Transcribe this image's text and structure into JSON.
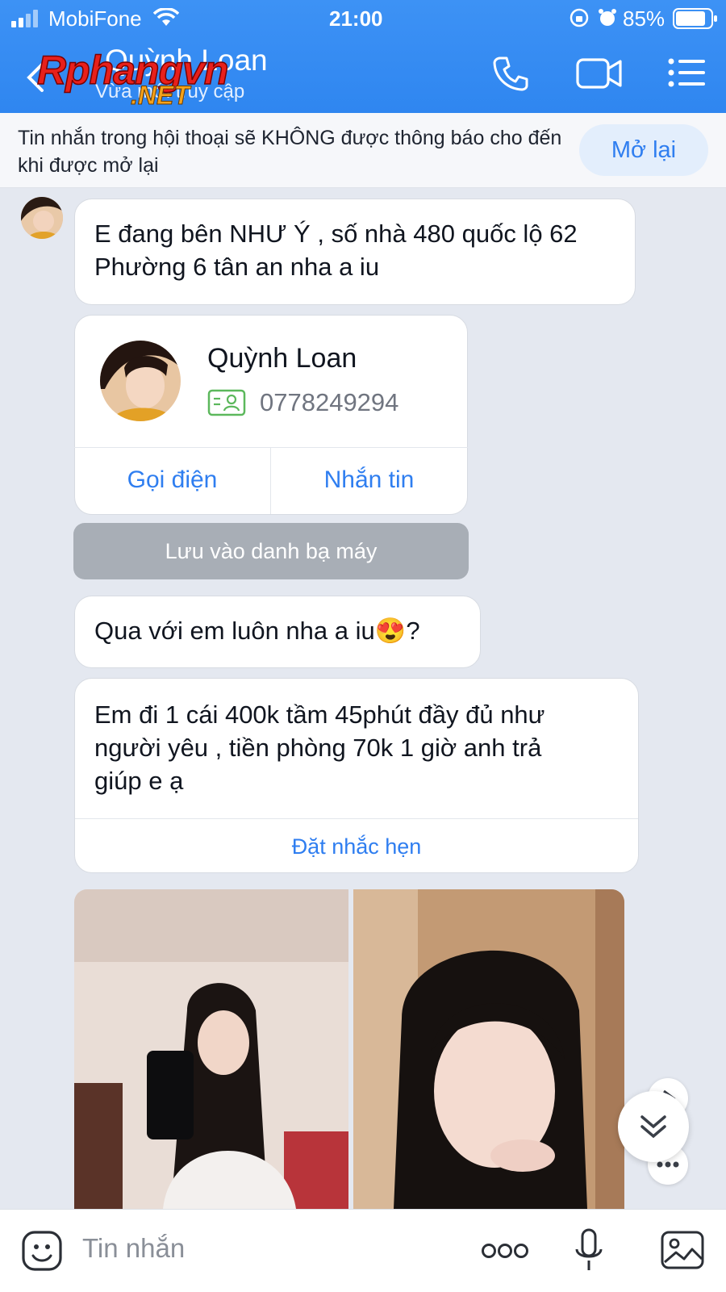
{
  "status_bar": {
    "carrier": "MobiFone",
    "time": "21:00",
    "battery": "85%"
  },
  "header": {
    "contact_name": "Quỳnh Loan",
    "presence": "Vừa mới truy cập",
    "icons": [
      "back-icon",
      "phone-icon",
      "video-call-icon",
      "menu-icon"
    ]
  },
  "watermark": {
    "text_main": "Rphangvn",
    "text_sub": ".NET"
  },
  "banner": {
    "text": "Tin nhắn trong hội thoại sẽ KHÔNG được thông báo cho đến khi được mở lại",
    "button": "Mở lại"
  },
  "messages": {
    "m1": "E đang bên NHƯ Ý  , số nhà 480 quốc lộ 62 Phường 6 tân an nha a iu",
    "contact_card": {
      "name": "Quỳnh Loan",
      "phone": "0778249294",
      "call": "Gọi điện",
      "message": "Nhắn tin",
      "save": "Lưu vào danh bạ máy"
    },
    "m2": "Qua với em luôn nha a iu😍?",
    "m3_line1": "Em đi 1 cái 400k tầm 45phút đầy đủ như",
    "m3_line2": "người yêu , tiền phòng 70k 1 giờ anh trả",
    "m3_line3": "giúp e ạ",
    "m3_action": "Đặt nhắc hẹn"
  },
  "input": {
    "placeholder": "Tin nhắn",
    "icons": [
      "sticker-icon",
      "more-icon",
      "microphone-icon",
      "image-icon"
    ]
  },
  "colors": {
    "header": "#3d92f5",
    "accent": "#2f7ef0",
    "chat_bg": "#e4e8f0"
  }
}
